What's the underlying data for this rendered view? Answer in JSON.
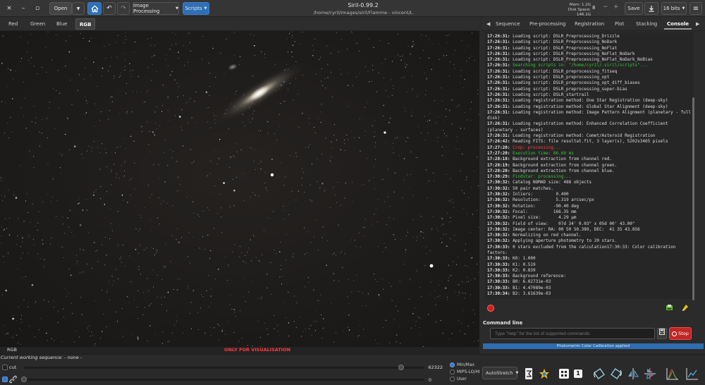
{
  "header": {
    "close_glyph": "×",
    "minimize_glyph": "–",
    "restore_glyph": "▫",
    "open_label": "Open",
    "image_processing_label": "Image Processing",
    "scripts_label": "Scripts",
    "title": "Siril-0.99.2",
    "path": "/home/cyril/Images/siril/Flamme - vincent/L",
    "mem": "Mem: 1.2G",
    "disk": "Disk Space: 146.1G",
    "threads_value": "8",
    "minus": "−",
    "plus": "+",
    "save_label": "Save",
    "bitdepth_label": "16 bits",
    "menu_glyph": "≡"
  },
  "channel_tabs": [
    "Red",
    "Green",
    "Blue",
    "RGB"
  ],
  "active_channel": "RGB",
  "image": {
    "label": "RGB",
    "visualisation_text": "ONLY FOR VISUALISATION"
  },
  "right_tabs": [
    "Sequence",
    "Pre-processing",
    "Registration",
    "Plot",
    "Stacking",
    "Console"
  ],
  "active_right_tab": "Console",
  "console": [
    {
      "ts": "17:26:31:",
      "msg": "Loading script: DSLR_Preprocessing_Drizzle",
      "c": ""
    },
    {
      "ts": "17:26:31:",
      "msg": "Loading script: DSLR_Preprocessing_NoDark",
      "c": ""
    },
    {
      "ts": "17:26:31:",
      "msg": "Loading script: DSLR_Preprocessing_NoFlat",
      "c": ""
    },
    {
      "ts": "17:26:31:",
      "msg": "Loading script: DSLR_Preprocessing_NoFlat_NoDark",
      "c": ""
    },
    {
      "ts": "17:26:31:",
      "msg": "Loading script: DSLR_Preprocessing_NoFlat_NoDark_NoBias",
      "c": ""
    },
    {
      "ts": "17:26:31:",
      "msg": "Searching scripts in: \"/home/cyril/.siril/scripts\"...",
      "c": "green"
    },
    {
      "ts": "17:26:31:",
      "msg": "Loading script: DSLR_preprocessing_fitseq",
      "c": ""
    },
    {
      "ts": "17:26:31:",
      "msg": "Loading script: DSLR_preprocessing_opt",
      "c": ""
    },
    {
      "ts": "17:26:31:",
      "msg": "Loading script: DSLR_preprocessing_opt_diff_biases",
      "c": ""
    },
    {
      "ts": "17:26:31:",
      "msg": "Loading script: DSLR_preprocessing_super-bias",
      "c": ""
    },
    {
      "ts": "17:26:31:",
      "msg": "Loading script: DSLR_startrail",
      "c": ""
    },
    {
      "ts": "17:26:31:",
      "msg": "Loading registration method: One Star Registration (deep-sky)",
      "c": ""
    },
    {
      "ts": "17:26:31:",
      "msg": "Loading registration method: Global Star Alignment (deep-sky)",
      "c": ""
    },
    {
      "ts": "17:26:31:",
      "msg": "Loading registration method: Image Pattern Alignment (planetary - full disk)",
      "c": ""
    },
    {
      "ts": "17:26:31:",
      "msg": "Loading registration method: Enhanced Correlation Coefficient (planetary - surfaces)",
      "c": ""
    },
    {
      "ts": "17:26:31:",
      "msg": "Loading registration method: Comet/Asteroid Registration",
      "c": ""
    },
    {
      "ts": "17:26:42:",
      "msg": "Reading FITS: file resultat.fit, 3 layer(s), 5202x3465 pixels",
      "c": ""
    },
    {
      "ts": "17:27:20:",
      "msg": "Crop: processing...",
      "c": "red"
    },
    {
      "ts": "17:27:20:",
      "msg": "Execution time: 86.60 ms",
      "c": "green"
    },
    {
      "ts": "17:28:18:",
      "msg": "Background extraction from channel red.",
      "c": ""
    },
    {
      "ts": "17:28:19:",
      "msg": "Background extraction from channel green.",
      "c": ""
    },
    {
      "ts": "17:28:20:",
      "msg": "Background extraction from channel blue.",
      "c": ""
    },
    {
      "ts": "17:30:29:",
      "msg": "Findstar: processing...",
      "c": "green"
    },
    {
      "ts": "17:30:32:",
      "msg": "Catalog NOMAD size: 488 objects",
      "c": ""
    },
    {
      "ts": "17:30:32:",
      "msg": "50 pair matches.",
      "c": ""
    },
    {
      "ts": "17:30:32:",
      "msg": "Inliers:         0.400",
      "c": ""
    },
    {
      "ts": "17:30:32:",
      "msg": "Resolution:      5.319 arcsec/px",
      "c": ""
    },
    {
      "ts": "17:30:32:",
      "msg": "Rotation:       -90.40 deg",
      "c": ""
    },
    {
      "ts": "17:30:32:",
      "msg": "Focal:          166.35 mm",
      "c": ""
    },
    {
      "ts": "17:30:32:",
      "msg": "Pixel size:       4.29 µm",
      "c": ""
    },
    {
      "ts": "17:30:32:",
      "msg": "Field of view:    07d 34' 0.03\" x 05d 00' 43.00\"",
      "c": ""
    },
    {
      "ts": "17:30:32:",
      "msg": "Image center: RA: 00 50 50.389, DEC:  41 35 43.856",
      "c": ""
    },
    {
      "ts": "17:30:32:",
      "msg": "Normalizing on red channel.",
      "c": ""
    },
    {
      "ts": "17:30:32:",
      "msg": "Applying aperture photometry to 20 stars.",
      "c": ""
    },
    {
      "ts": "17:30:33:",
      "msg": "0 stars excluded from the calculation17:30:33: Color calibration factors:",
      "c": ""
    },
    {
      "ts": "17:30:33:",
      "msg": "K0: 1.000",
      "c": ""
    },
    {
      "ts": "17:30:33:",
      "msg": "K1: 0.519",
      "c": ""
    },
    {
      "ts": "17:30:33:",
      "msg": "K2: 0.839",
      "c": ""
    },
    {
      "ts": "17:30:33:",
      "msg": "Background reference:",
      "c": ""
    },
    {
      "ts": "17:30:33:",
      "msg": "B0: 6.02731e-03",
      "c": ""
    },
    {
      "ts": "17:30:33:",
      "msg": "B1: 4.47089e-03",
      "c": ""
    },
    {
      "ts": "17:30:34:",
      "msg": "B2: 3.61639e-03",
      "c": ""
    }
  ],
  "command": {
    "heading": "Command line",
    "placeholder": "Type \"help\" for the list of supported commands",
    "stop_label": "Stop"
  },
  "progress": {
    "text": "Photometric Color Calibration applied",
    "fraction": 1.0
  },
  "bottom": {
    "sequence_text": "Current working sequence: - none -",
    "cut_label": "cut",
    "high_value": "62322",
    "low_value": "0",
    "radio_options": [
      "Min/Max",
      "MIPS-LO/HI",
      "User"
    ],
    "selected_radio": "Min/Max",
    "stretch_label": "AutoStretch",
    "zoom_label": "1"
  },
  "colors": {
    "accent": "#2f6fb5",
    "stop": "#c12626",
    "console_green": "#3cc53c",
    "console_red": "#ff4040"
  }
}
